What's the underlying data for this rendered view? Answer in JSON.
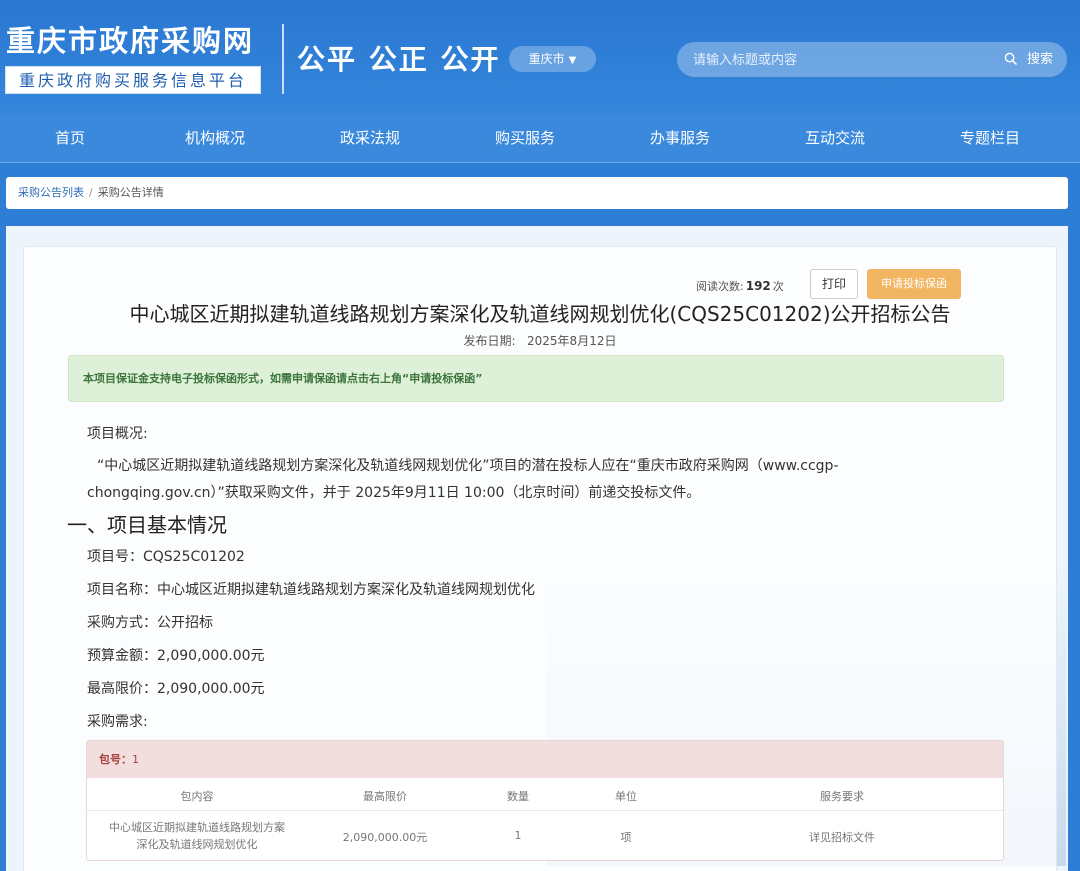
{
  "header": {
    "site_title": "重庆市政府采购网",
    "site_subtitle": "重庆政府购买服务信息平台",
    "slogan": "公平 公正 公开",
    "region_label": "重庆市",
    "search_placeholder": "请输入标题或内容",
    "search_button": "搜索",
    "accent_color": "#2f7ed6"
  },
  "nav": {
    "items": [
      {
        "label": "首页"
      },
      {
        "label": "机构概况"
      },
      {
        "label": "政采法规"
      },
      {
        "label": "购买服务"
      },
      {
        "label": "办事服务"
      },
      {
        "label": "互动交流"
      },
      {
        "label": "专题栏目"
      }
    ]
  },
  "breadcrumb": {
    "items": [
      "采购公告列表",
      "采购公告详情"
    ],
    "separator": "/"
  },
  "article": {
    "views_label": "阅读次数:",
    "views_count": "192",
    "views_unit": "次",
    "print_button": "打印",
    "apply_button": "申请投标保函",
    "title": "中心城区近期拟建轨道线路规划方案深化及轨道线网规划优化(CQS25C01202)公开招标公告",
    "publish_label": "发布日期:",
    "publish_date": "2025年8月12日",
    "notice": "本项目保证金支持电子投标保函形式，如需申请保函请点击右上角“申请投标保函”",
    "overview_label": "项目概况:",
    "overview_text": "“中心城区近期拟建轨道线路规划方案深化及轨道线网规划优化”项目的潜在投标人应在“重庆市政府采购网（www.ccgp-chongqing.gov.cn）”获取采购文件，并于 2025年9月11日 10:00（北京时间）前递交投标文件。",
    "section1_title": "一、项目基本情况",
    "fields": [
      {
        "label": "项目号：",
        "value": "CQS25C01202"
      },
      {
        "label": "项目名称：",
        "value": "中心城区近期拟建轨道线路规划方案深化及轨道线网规划优化"
      },
      {
        "label": "采购方式：",
        "value": "公开招标"
      },
      {
        "label": "预算金额：",
        "value": "2,090,000.00元"
      },
      {
        "label": "最高限价：",
        "value": "2,090,000.00元"
      }
    ],
    "requirements_label": "采购需求:"
  },
  "package": {
    "label": "包号：",
    "number": "1",
    "columns": [
      "包内容",
      "最高限价",
      "数量",
      "单位",
      "服务要求"
    ],
    "rows": [
      {
        "content_line1": "中心城区近期拟建轨道线路规划方案",
        "content_line2": "深化及轨道线网规划优化",
        "max_price": "2,090,000.00元",
        "quantity": "1",
        "unit": "项",
        "service": "详见招标文件"
      }
    ]
  }
}
